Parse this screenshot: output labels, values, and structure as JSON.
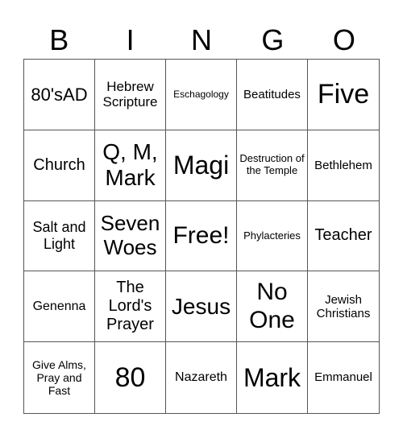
{
  "header": [
    "B",
    "I",
    "N",
    "G",
    "O"
  ],
  "cells": [
    [
      "80'sAD",
      "Hebrew Scripture",
      "Eschagology",
      "Beatitudes",
      "Five"
    ],
    [
      "Church",
      "Q, M, Mark",
      "Magi",
      "Destruction of the Temple",
      "Bethlehem"
    ],
    [
      "Salt and Light",
      "Seven Woes",
      "Free!",
      "Phylacteries",
      "Teacher"
    ],
    [
      "Genenna",
      "The Lord's Prayer",
      "Jesus",
      "No One",
      "Jewish Christians"
    ],
    [
      "Give Alms, Pray and Fast",
      "80",
      "Nazareth",
      "Mark",
      "Emmanuel"
    ]
  ]
}
